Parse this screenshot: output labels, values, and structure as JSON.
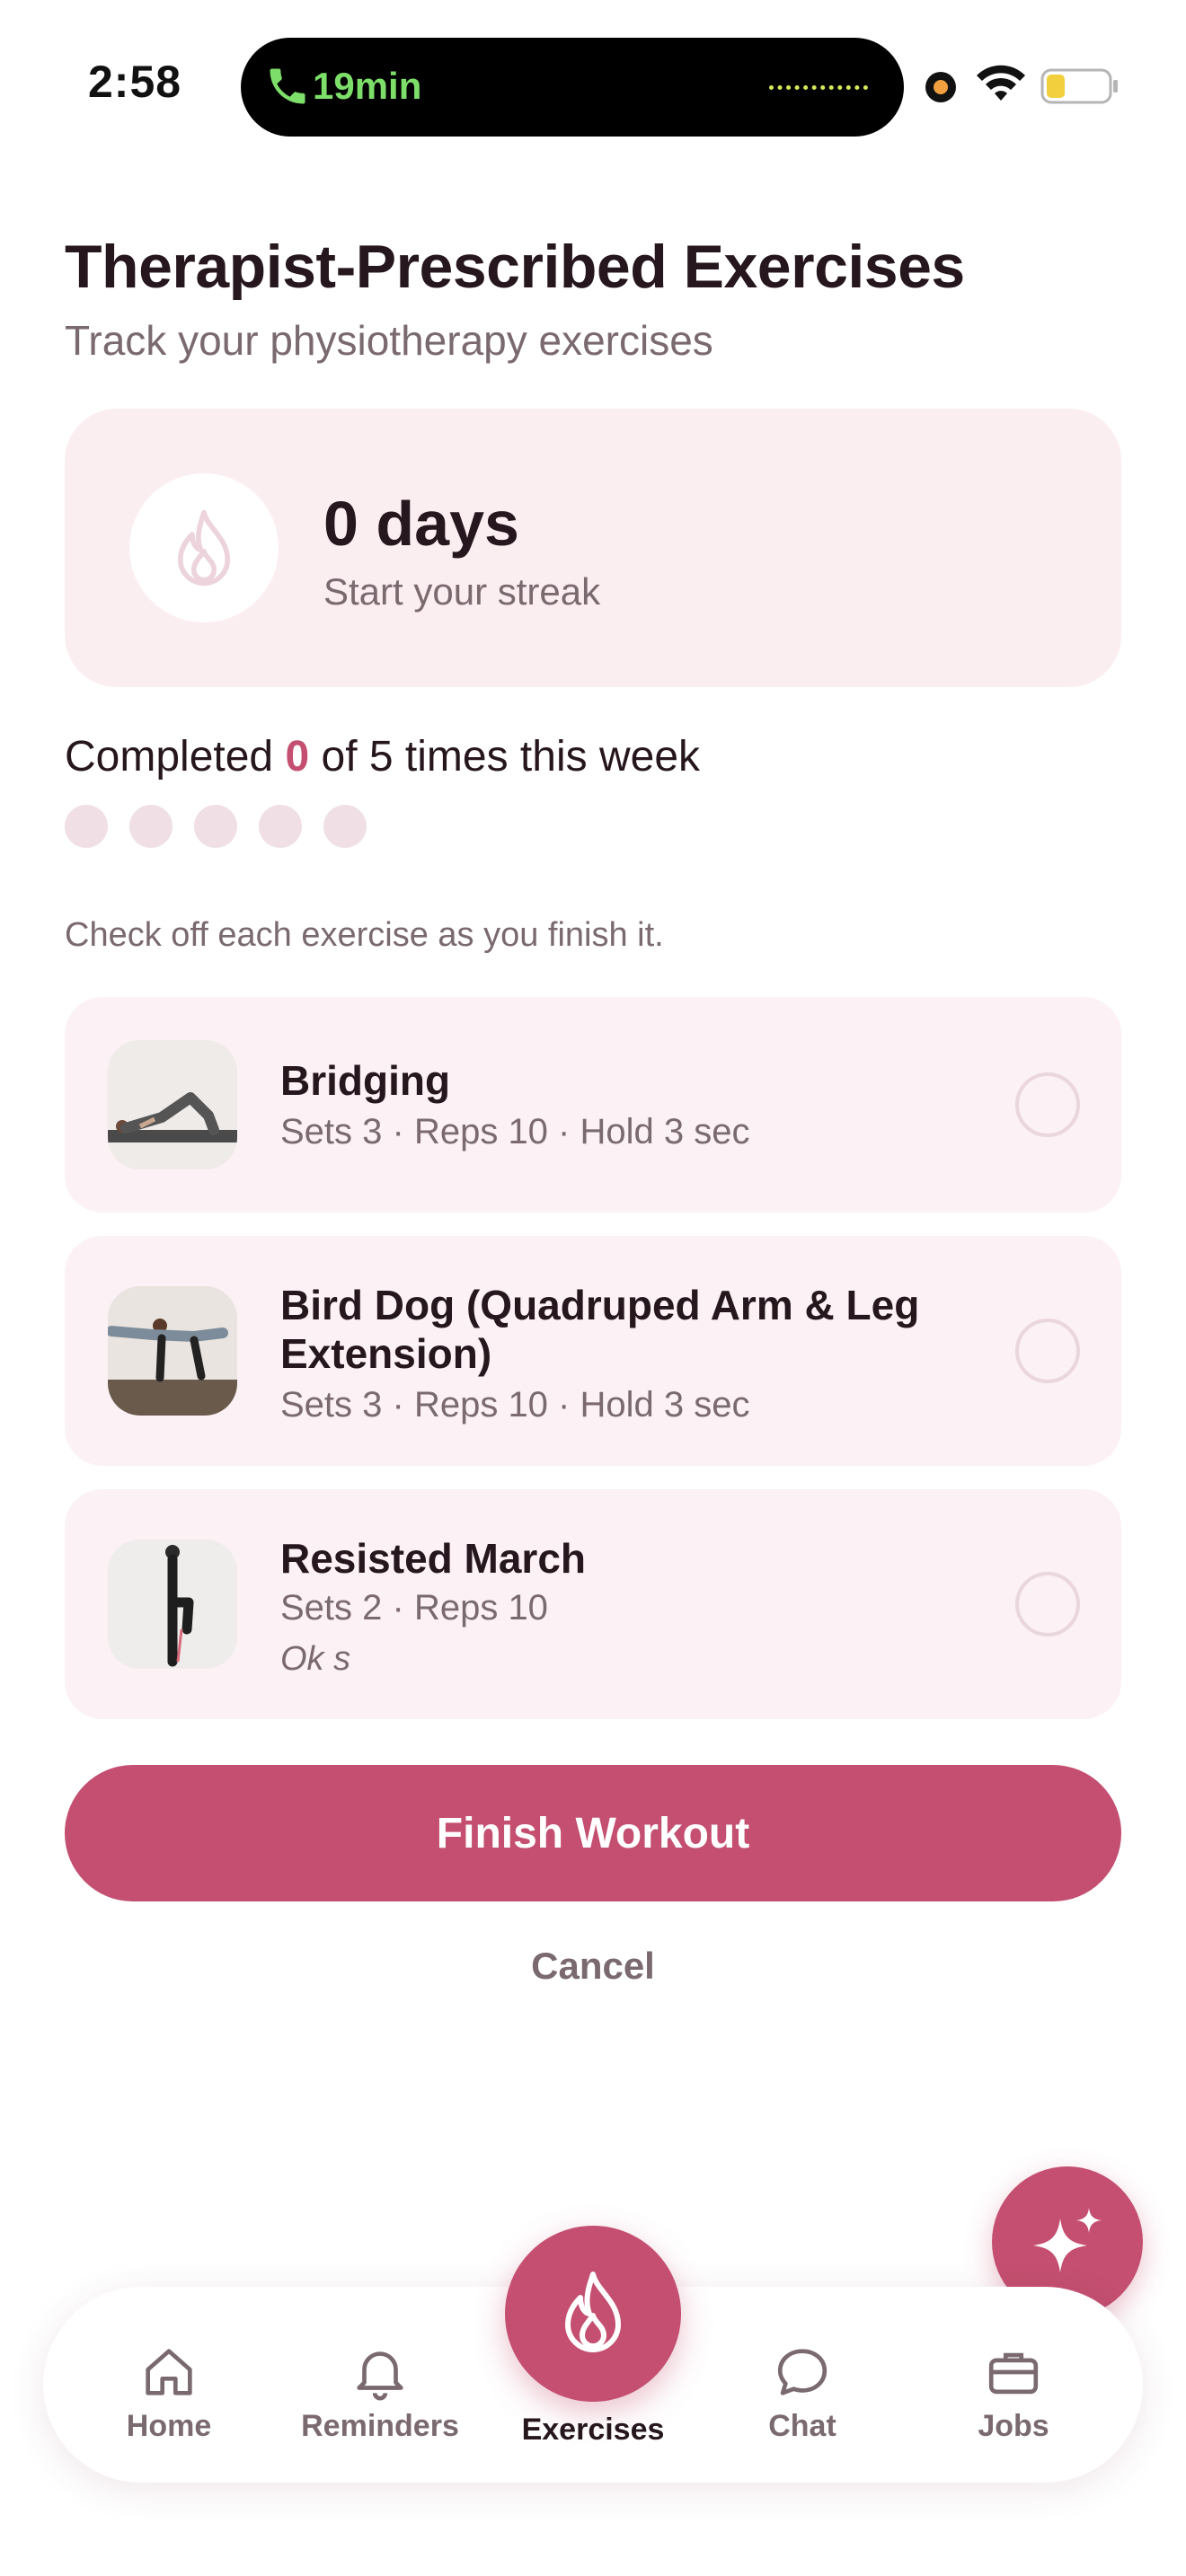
{
  "status_bar": {
    "time": "2:58",
    "call_duration": "19min",
    "call_color": "#7ddf6a"
  },
  "header": {
    "title": "Therapist-Prescribed Exercises",
    "subtitle": "Track your physiotherapy exercises"
  },
  "streak": {
    "icon": "flame-icon",
    "value": "0 days",
    "label": "Start your streak"
  },
  "weekly": {
    "prefix": "Completed ",
    "completed": "0",
    "suffix": " of 5 times this week",
    "target": 5,
    "done": 0
  },
  "hint": "Check off each exercise as you finish it.",
  "exercises": [
    {
      "name": "Bridging",
      "meta": "Sets 3 · Reps 10 · Hold 3 sec",
      "note": "",
      "checked": false
    },
    {
      "name": "Bird Dog (Quadruped Arm & Leg Extension)",
      "meta": "Sets 3 · Reps 10 · Hold 3 sec",
      "note": "",
      "checked": false
    },
    {
      "name": "Resisted March",
      "meta": "Sets 2 · Reps 10",
      "note": "Ok s",
      "checked": false
    }
  ],
  "actions": {
    "finish": "Finish Workout",
    "cancel": "Cancel"
  },
  "nav": {
    "items": [
      {
        "label": "Home",
        "icon": "home-icon"
      },
      {
        "label": "Reminders",
        "icon": "bell-icon"
      },
      {
        "label": "Exercises",
        "icon": "flame-icon",
        "active": true
      },
      {
        "label": "Chat",
        "icon": "chat-bubble-icon"
      },
      {
        "label": "Jobs",
        "icon": "briefcase-icon"
      }
    ]
  },
  "colors": {
    "accent": "#c44f70",
    "card_bg": "#fbeef1",
    "text_dark": "#26161d",
    "text_muted": "#7a6a70"
  }
}
